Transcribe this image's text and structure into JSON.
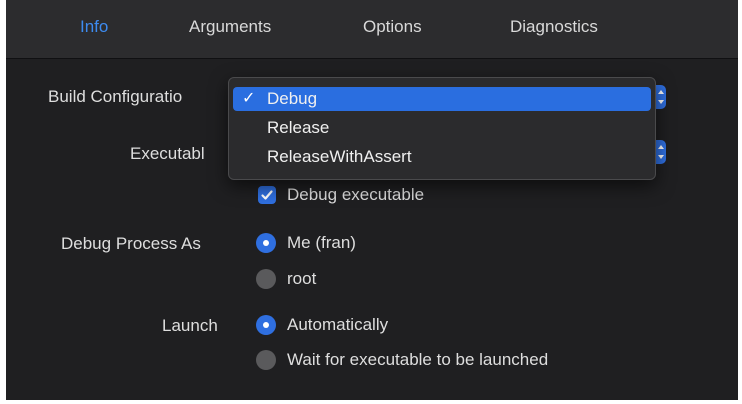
{
  "tabs": [
    {
      "label": "Info",
      "active": true
    },
    {
      "label": "Arguments",
      "active": false
    },
    {
      "label": "Options",
      "active": false
    },
    {
      "label": "Diagnostics",
      "active": false
    }
  ],
  "build_configuration": {
    "label": "Build Configuratio",
    "menu": {
      "options": [
        "Debug",
        "Release",
        "ReleaseWithAssert"
      ],
      "selected": "Debug",
      "check_glyph": "✓"
    }
  },
  "executable": {
    "label": "Executabl"
  },
  "debug_executable": {
    "label": "Debug executable",
    "checked": true
  },
  "debug_process_as": {
    "label": "Debug Process As",
    "options": [
      {
        "label": "Me (fran)",
        "selected": true
      },
      {
        "label": "root",
        "selected": false
      }
    ]
  },
  "launch": {
    "label": "Launch",
    "options": [
      {
        "label": "Automatically",
        "selected": true
      },
      {
        "label": "Wait for executable to be launched",
        "selected": false
      }
    ]
  },
  "colors": {
    "accent": "#2f6fe0",
    "active_tab": "#3d8bf0",
    "background": "#1f1f21",
    "tabbar": "#2c2c2e"
  },
  "icons": {
    "popup_arrows": "chevron-up-down-icon",
    "check": "checkmark-icon"
  }
}
